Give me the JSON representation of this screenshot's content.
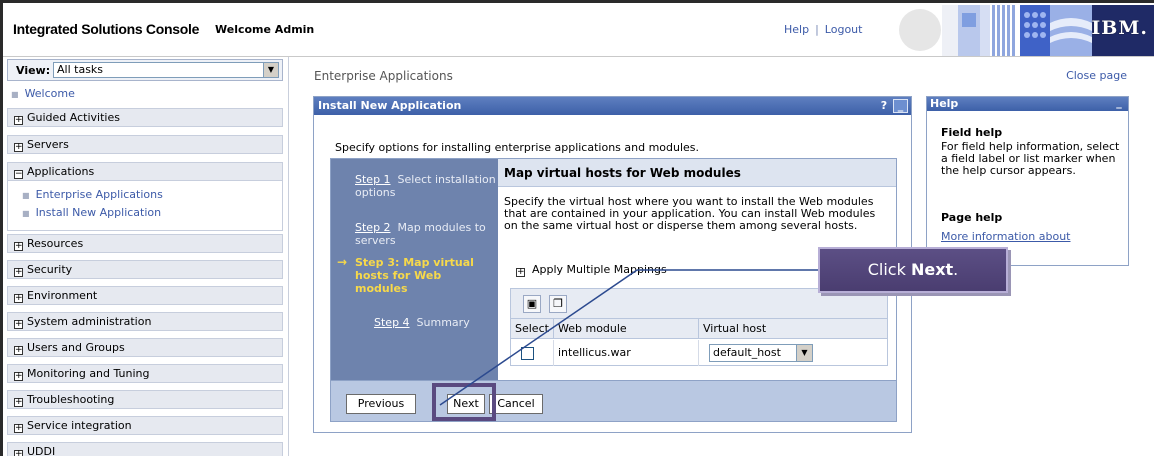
{
  "banner": {
    "title": "Integrated Solutions Console",
    "welcome": "Welcome Admin",
    "help_link": "Help",
    "separator": "|",
    "logout_link": "Logout",
    "logo_text": "IBM."
  },
  "nav": {
    "view_label": "View:",
    "view_value": "All tasks",
    "welcome": "Welcome",
    "categories": [
      {
        "label": "Guided Activities",
        "expanded": false
      },
      {
        "label": "Servers",
        "expanded": false
      },
      {
        "label": "Applications",
        "expanded": true
      },
      {
        "label": "Resources",
        "expanded": false
      },
      {
        "label": "Security",
        "expanded": false
      },
      {
        "label": "Environment",
        "expanded": false
      },
      {
        "label": "System administration",
        "expanded": false
      },
      {
        "label": "Users and Groups",
        "expanded": false
      },
      {
        "label": "Monitoring and Tuning",
        "expanded": false
      },
      {
        "label": "Troubleshooting",
        "expanded": false
      },
      {
        "label": "Service integration",
        "expanded": false
      },
      {
        "label": "UDDI",
        "expanded": false
      }
    ],
    "applications_items": [
      "Enterprise Applications",
      "Install New Application"
    ]
  },
  "content": {
    "breadcrumb": "Enterprise Applications",
    "close_page": "Close page",
    "portlet_title": "Install New Application",
    "help_btn": "?",
    "min_btn": "_",
    "intro": "Specify options for installing enterprise applications and modules."
  },
  "wizard": {
    "steps": [
      {
        "link": "Step 1",
        "text": "Select installation options"
      },
      {
        "link": "Step 2",
        "text": "Map modules to servers"
      },
      {
        "current": "Step 3: Map virtual hosts for Web modules"
      },
      {
        "link": "Step 4",
        "text": "Summary"
      }
    ],
    "arrow": "→",
    "panel_title": "Map virtual hosts for Web modules",
    "panel_desc": "Specify the virtual host where you want to install the Web modules that are contained in your application. You can install Web modules on the same virtual host or disperse them among several hosts.",
    "apply_multiple": "Apply Multiple Mappings",
    "table": {
      "headers": [
        "Select",
        "Web module",
        "Virtual host"
      ],
      "rows": [
        {
          "module": "intellicus.war",
          "virtual_host": "default_host"
        }
      ]
    },
    "buttons": {
      "previous": "Previous",
      "next": "Next",
      "cancel": "Cancel"
    }
  },
  "help": {
    "title": "Help",
    "min_btn": "_",
    "field_help_title": "Field help",
    "field_help_text": "For field help information, select a field label or list marker when the help cursor appears.",
    "page_help_title": "Page help",
    "page_help_link": "More information about"
  },
  "callout": {
    "prefix": "Click ",
    "bold": "Next",
    "suffix": "."
  },
  "colors": {
    "header_blue": "#3d60a8",
    "step_panel": "#6e83ad",
    "callout_purple": "#5c4f85",
    "link_blue": "#3c5aa8",
    "current_step_yellow": "#f7d94a"
  }
}
